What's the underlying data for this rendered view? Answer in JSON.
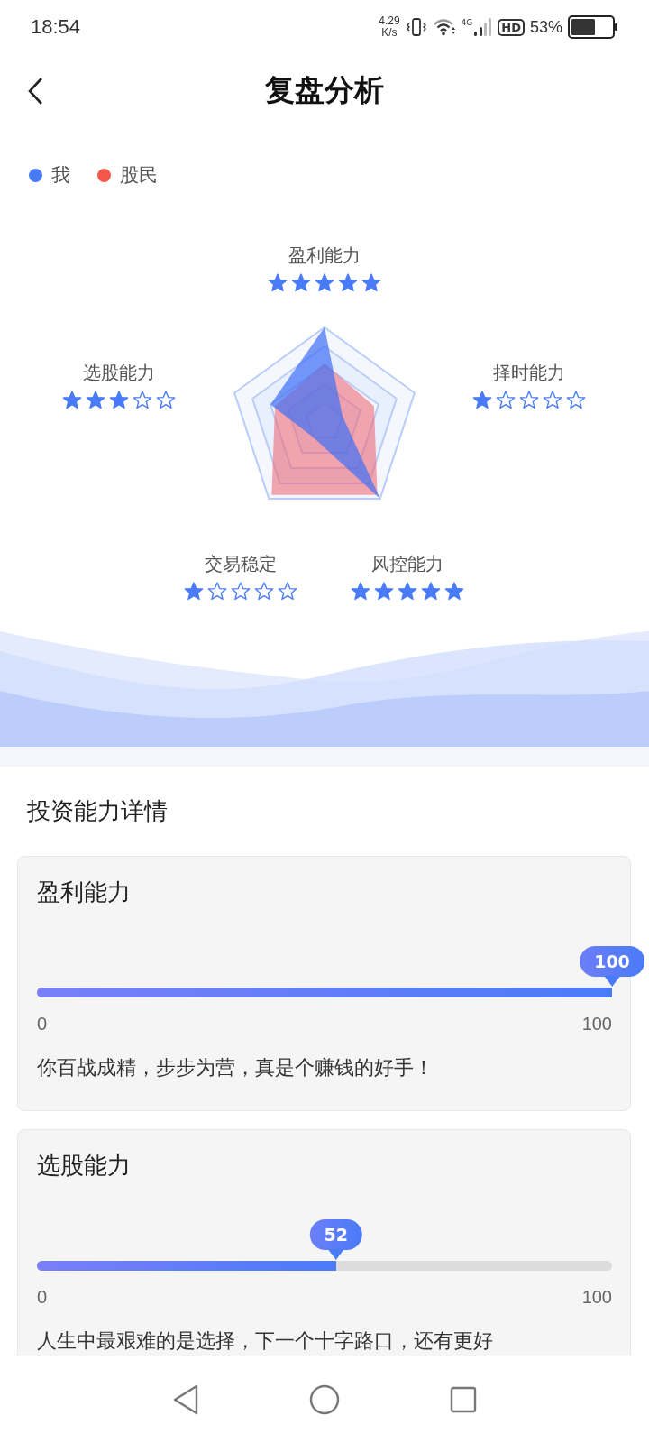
{
  "status_bar": {
    "time": "18:54",
    "speed_value": "4.29",
    "speed_unit": "K/s",
    "network": "4G",
    "hd": "HD",
    "battery": "53%"
  },
  "header": {
    "title": "复盘分析"
  },
  "legend": [
    {
      "label": "我",
      "color": "#4a7bf7"
    },
    {
      "label": "股民",
      "color": "#f5584a"
    }
  ],
  "radar": {
    "axes": [
      {
        "label": "盈利能力",
        "stars": 5
      },
      {
        "label": "择时能力",
        "stars": 1
      },
      {
        "label": "风控能力",
        "stars": 5
      },
      {
        "label": "交易稳定",
        "stars": 1
      },
      {
        "label": "选股能力",
        "stars": 3
      }
    ]
  },
  "details": {
    "title": "投资能力详情",
    "cards": [
      {
        "title": "盈利能力",
        "value": "100",
        "level": 1.0,
        "min": "0",
        "max": "100",
        "comment": "你百战成精，步步为营，真是个赚钱的好手！"
      },
      {
        "title": "选股能力",
        "value": "52",
        "level": 0.52,
        "min": "0",
        "max": "100",
        "comment": "人生中最艰难的是选择，下一个十字路口，还有更好"
      }
    ]
  }
}
